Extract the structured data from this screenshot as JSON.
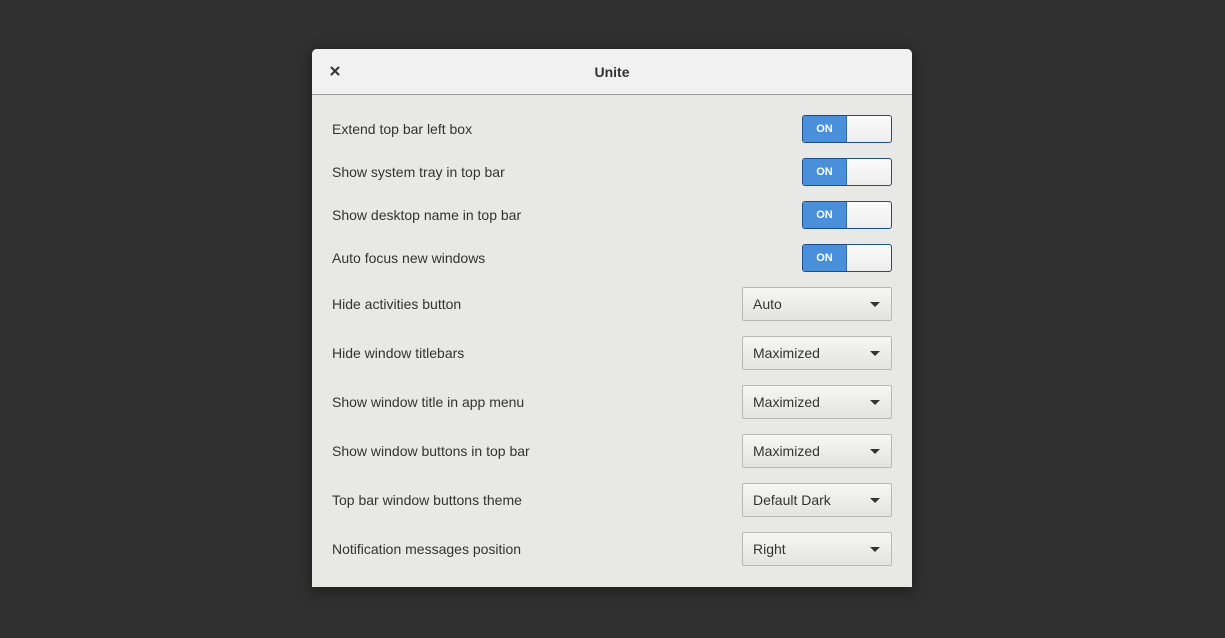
{
  "window": {
    "title": "Unite",
    "close_icon": "close-icon"
  },
  "toggles": [
    {
      "label": "Extend top bar left box",
      "state": "ON"
    },
    {
      "label": "Show system tray in top bar",
      "state": "ON"
    },
    {
      "label": "Show desktop name in top bar",
      "state": "ON"
    },
    {
      "label": "Auto focus new windows",
      "state": "ON"
    }
  ],
  "dropdowns": [
    {
      "label": "Hide activities button",
      "value": "Auto"
    },
    {
      "label": "Hide window titlebars",
      "value": "Maximized"
    },
    {
      "label": "Show window title in app menu",
      "value": "Maximized"
    },
    {
      "label": "Show window buttons in top bar",
      "value": "Maximized"
    },
    {
      "label": "Top bar window buttons theme",
      "value": "Default Dark"
    },
    {
      "label": "Notification messages position",
      "value": "Right"
    }
  ],
  "colors": {
    "background": "#303030",
    "accent": "#4a8fd9",
    "dialog": "#e8e8e7"
  }
}
